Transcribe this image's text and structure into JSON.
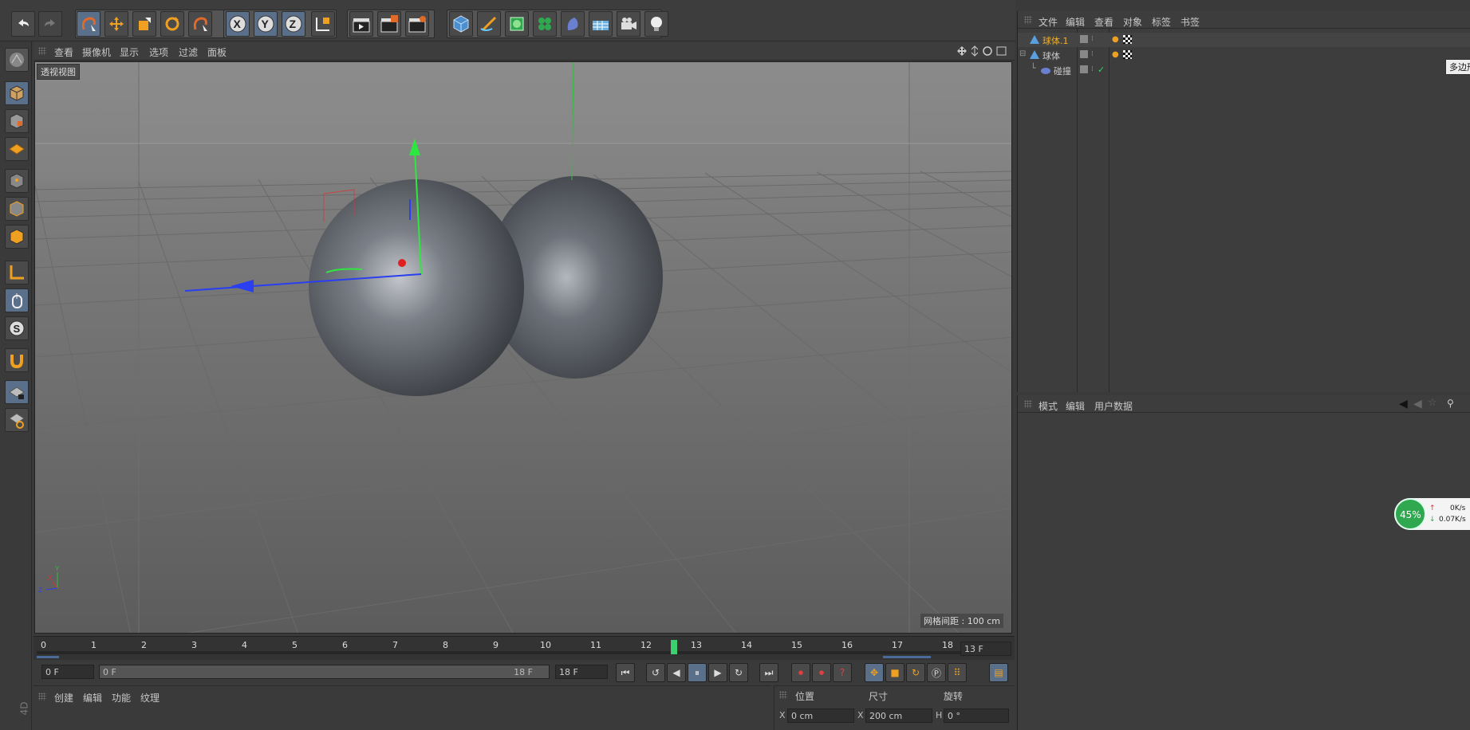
{
  "viewport": {
    "menu": [
      "查看",
      "摄像机",
      "显示",
      "选项",
      "过滤",
      "面板"
    ],
    "label": "透视视图",
    "grid_spacing": "网格间距 : 100 cm"
  },
  "object_manager": {
    "menu": [
      "文件",
      "编辑",
      "查看",
      "对象",
      "标签",
      "书签"
    ],
    "objects": [
      {
        "name": "球体.1",
        "selected": true
      },
      {
        "name": "球体",
        "selected": false
      },
      {
        "name": "碰撞",
        "selected": false
      }
    ],
    "tooltip": "多边形"
  },
  "attribute_manager": {
    "menu": [
      "模式",
      "编辑",
      "用户数据"
    ]
  },
  "timeline": {
    "ticks": [
      "0",
      "1",
      "2",
      "3",
      "4",
      "5",
      "6",
      "7",
      "8",
      "9",
      "10",
      "11",
      "12",
      "13",
      "14",
      "15",
      "16",
      "17",
      "18"
    ],
    "current_frame": "13 F",
    "start_field": "0 F",
    "range_start": "0 F",
    "range_end": "18 F",
    "end_field": "18 F"
  },
  "material_manager": {
    "menu": [
      "创建",
      "编辑",
      "功能",
      "纹理"
    ]
  },
  "coordinates": {
    "headers": [
      "位置",
      "尺寸",
      "旋转"
    ],
    "x_position": "0 cm",
    "x_size": "200 cm",
    "h_rotation": "0 °"
  },
  "net_widget": {
    "percent": "45%",
    "up": "0K/s",
    "down": "0.07K/s"
  },
  "side_label": "4D"
}
